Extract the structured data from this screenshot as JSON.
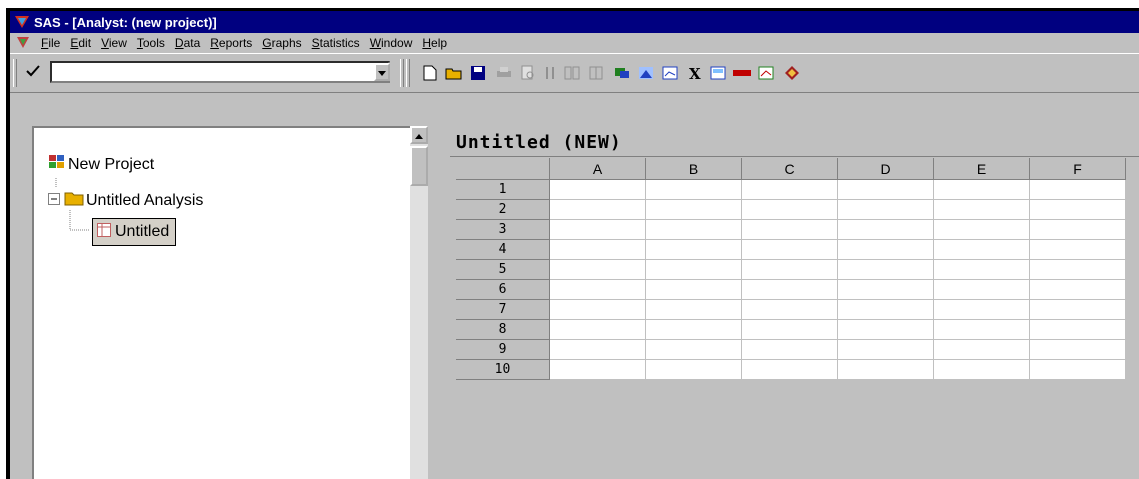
{
  "window": {
    "title": "SAS - [Analyst: (new project)]"
  },
  "menu": {
    "items": [
      {
        "key": "F",
        "rest": "ile"
      },
      {
        "key": "E",
        "rest": "dit"
      },
      {
        "key": "V",
        "rest": "iew"
      },
      {
        "key": "T",
        "rest": "ools"
      },
      {
        "key": "D",
        "rest": "ata"
      },
      {
        "key": "R",
        "rest": "eports"
      },
      {
        "key": "G",
        "rest": "raphs"
      },
      {
        "key": "S",
        "rest": "tatistics"
      },
      {
        "key": "W",
        "rest": "indow"
      },
      {
        "key": "H",
        "rest": "elp"
      }
    ]
  },
  "toolbar": {
    "command_value": "",
    "tools": [
      "new-document-icon",
      "open-folder-icon",
      "save-icon",
      "print-icon",
      "print-preview-icon",
      "sort-icon",
      "split-columns-icon",
      "columns-icon",
      "dataset-icon",
      "histogram-icon",
      "chart-icon",
      "sigma-icon",
      "calculator-icon",
      "pval-icon",
      "scatter-icon",
      "help-book-icon"
    ]
  },
  "project_tree": {
    "root": "New Project",
    "analysis": "Untitled Analysis",
    "table": "Untitled"
  },
  "sheet": {
    "title": "Untitled (NEW)",
    "columns": [
      "A",
      "B",
      "C",
      "D",
      "E",
      "F"
    ],
    "rows": [
      "1",
      "2",
      "3",
      "4",
      "5",
      "6",
      "7",
      "8",
      "9",
      "10"
    ]
  },
  "colors": {
    "title_bar": "#000080",
    "face": "#c0c0c0",
    "folder": "#e8b000",
    "red_accent": "#c00000"
  }
}
